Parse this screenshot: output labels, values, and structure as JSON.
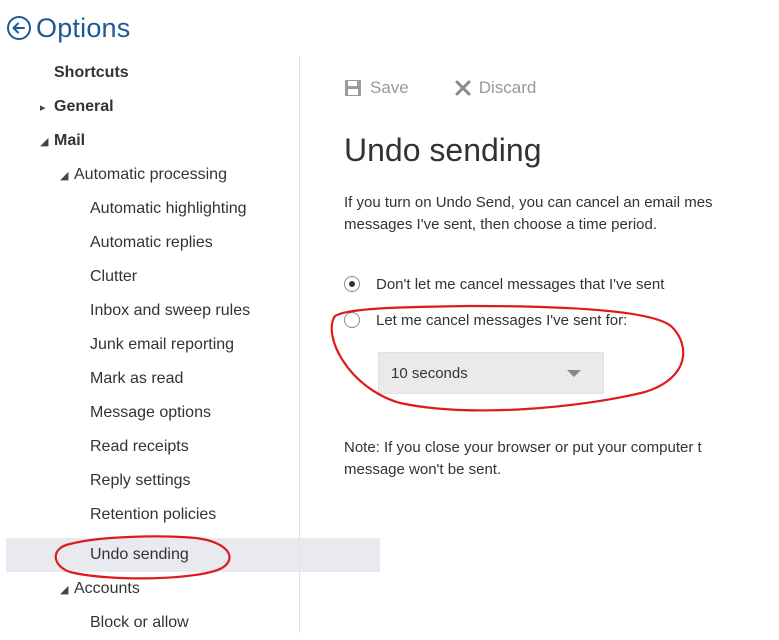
{
  "header": {
    "title": "Options",
    "back_icon": "back-arrow-circle-icon"
  },
  "sidebar": {
    "items": [
      {
        "label": "Shortcuts",
        "bold": true
      },
      {
        "label": "General",
        "bold": true,
        "caret": "collapsed"
      },
      {
        "label": "Mail",
        "bold": true,
        "caret": "expanded"
      },
      {
        "label": "Automatic processing",
        "caret": "expanded"
      },
      {
        "label": "Automatic highlighting"
      },
      {
        "label": "Automatic replies"
      },
      {
        "label": "Clutter"
      },
      {
        "label": "Inbox and sweep rules"
      },
      {
        "label": "Junk email reporting"
      },
      {
        "label": "Mark as read"
      },
      {
        "label": "Message options"
      },
      {
        "label": "Read receipts"
      },
      {
        "label": "Reply settings"
      },
      {
        "label": "Retention policies"
      },
      {
        "label": "Undo sending",
        "active": true
      },
      {
        "label": "Accounts",
        "caret": "expanded"
      },
      {
        "label": "Block or allow"
      }
    ]
  },
  "toolbar": {
    "save_label": "Save",
    "discard_label": "Discard"
  },
  "main": {
    "title": "Undo sending",
    "description_line1": "If you turn on Undo Send, you can cancel an email mes",
    "description_line2": "messages I've sent, then choose a time period.",
    "option_dont_cancel": "Don't let me cancel messages that I've sent",
    "option_let_cancel": "Let me cancel messages I've sent for:",
    "selected_option": "dont_cancel",
    "time_select_value": "10 seconds",
    "note_line1": "Note: If you close your browser or put your computer t",
    "note_line2": "message won't be sent."
  },
  "colors": {
    "accent": "#1c5a96",
    "annotation": "#e0191c",
    "active_item_bg": "#e9e9f0"
  }
}
